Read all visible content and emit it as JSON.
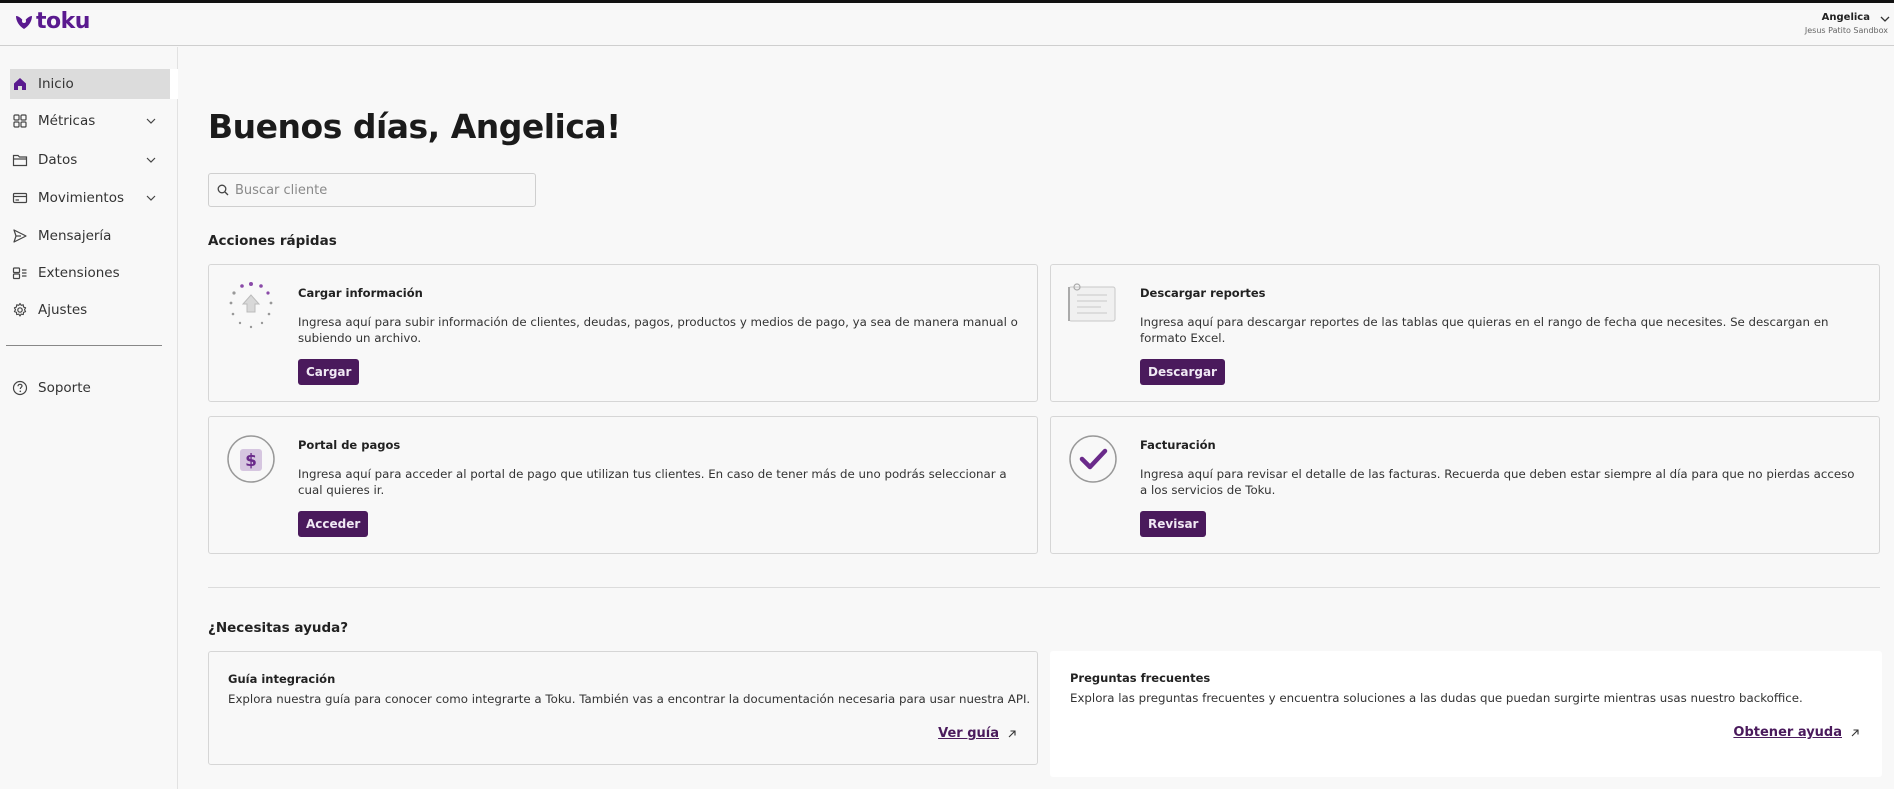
{
  "brand": {
    "name": "toku",
    "color": "#5a1a8f"
  },
  "user": {
    "name": "Angelica",
    "org": "Jesus Patito Sandbox"
  },
  "sidebar": {
    "items": [
      {
        "label": "Inicio",
        "icon": "home-icon",
        "active": true
      },
      {
        "label": "Métricas",
        "icon": "grid-icon",
        "expandable": true
      },
      {
        "label": "Datos",
        "icon": "folder-icon",
        "expandable": true
      },
      {
        "label": "Movimientos",
        "icon": "card-icon",
        "expandable": true
      },
      {
        "label": "Mensajería",
        "icon": "send-icon"
      },
      {
        "label": "Extensiones",
        "icon": "extensions-icon"
      },
      {
        "label": "Ajustes",
        "icon": "gear-icon"
      },
      {
        "label": "Soporte",
        "icon": "help-icon"
      }
    ]
  },
  "main": {
    "greeting": "Buenos días, Angelica!",
    "search_placeholder": "Buscar cliente",
    "quick_actions_title": "Acciones rápidas",
    "quick_actions": [
      {
        "title": "Cargar información",
        "desc": "Ingresa aquí para subir información de clientes, deudas, pagos, productos y medios de pago, ya sea de manera manual o subiendo un archivo.",
        "button": "Cargar",
        "icon": "upload-illustration-icon"
      },
      {
        "title": "Descargar reportes",
        "desc": "Ingresa aquí para descargar reportes de las tablas que quieras en el rango de fecha que necesites. Se descargan en formato Excel.",
        "button": "Descargar",
        "icon": "report-illustration-icon"
      },
      {
        "title": "Portal de pagos",
        "desc": "Ingresa aquí para acceder al portal de pago que utilizan tus clientes. En caso de tener más de uno podrás seleccionar a cual quieres ir.",
        "button": "Acceder",
        "icon": "payment-portal-illustration-icon"
      },
      {
        "title": "Facturación",
        "desc": "Ingresa aquí para revisar el detalle de las facturas. Recuerda que deben estar siempre al día para que no pierdas acceso a los servicios de Toku.",
        "button": "Revisar",
        "icon": "billing-check-illustration-icon"
      }
    ],
    "help_title": "¿Necesitas ayuda?",
    "help_cards": [
      {
        "title": "Guía integración",
        "desc": "Explora nuestra guía para conocer como integrarte a Toku. También vas a encontrar la documentación necesaria para usar nuestra API.",
        "link": "Ver guía"
      },
      {
        "title": "Preguntas frecuentes",
        "desc": "Explora las preguntas frecuentes y encuentra soluciones a las dudas que puedan surgirte mientras usas nuestro backoffice.",
        "link": "Obtener ayuda"
      }
    ]
  },
  "colors": {
    "accent": "#4a1a5c",
    "brand": "#5a1a8f"
  }
}
